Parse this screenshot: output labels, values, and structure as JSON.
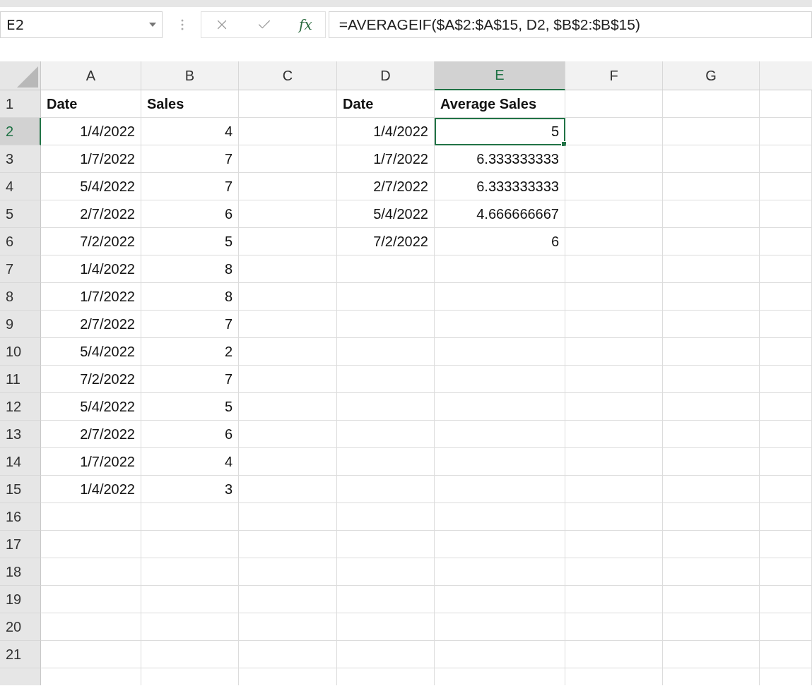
{
  "formula_bar": {
    "name_box": "E2",
    "function_label": "fx",
    "formula": "=AVERAGEIF($A$2:$A$15, D2, $B$2:$B$15)"
  },
  "columns": [
    {
      "label": "A",
      "selected": false
    },
    {
      "label": "B",
      "selected": false
    },
    {
      "label": "C",
      "selected": false
    },
    {
      "label": "D",
      "selected": false
    },
    {
      "label": "E",
      "selected": true
    },
    {
      "label": "F",
      "selected": false
    },
    {
      "label": "G",
      "selected": false
    }
  ],
  "rows": [
    {
      "number": "1",
      "selected": false,
      "cells": [
        {
          "kind": "header",
          "text": "Date"
        },
        {
          "kind": "header",
          "text": "Sales"
        },
        {
          "kind": "empty"
        },
        {
          "kind": "header",
          "text": "Date"
        },
        {
          "kind": "header",
          "text": "Average Sales"
        }
      ]
    },
    {
      "number": "2",
      "selected": true,
      "cells": [
        {
          "kind": "date",
          "text": "1/4/2022"
        },
        {
          "kind": "number",
          "text": "4"
        },
        {
          "kind": "empty"
        },
        {
          "kind": "date",
          "text": "1/4/2022"
        },
        {
          "kind": "number",
          "text": "5"
        }
      ]
    },
    {
      "number": "3",
      "selected": false,
      "cells": [
        {
          "kind": "date",
          "text": "1/7/2022"
        },
        {
          "kind": "number",
          "text": "7"
        },
        {
          "kind": "empty"
        },
        {
          "kind": "date",
          "text": "1/7/2022"
        },
        {
          "kind": "number",
          "text": "6.333333333"
        }
      ]
    },
    {
      "number": "4",
      "selected": false,
      "cells": [
        {
          "kind": "date",
          "text": "5/4/2022"
        },
        {
          "kind": "number",
          "text": "7"
        },
        {
          "kind": "empty"
        },
        {
          "kind": "date",
          "text": "2/7/2022"
        },
        {
          "kind": "number",
          "text": "6.333333333"
        }
      ]
    },
    {
      "number": "5",
      "selected": false,
      "cells": [
        {
          "kind": "date",
          "text": "2/7/2022"
        },
        {
          "kind": "number",
          "text": "6"
        },
        {
          "kind": "empty"
        },
        {
          "kind": "date",
          "text": "5/4/2022"
        },
        {
          "kind": "number",
          "text": "4.666666667"
        }
      ]
    },
    {
      "number": "6",
      "selected": false,
      "cells": [
        {
          "kind": "date",
          "text": "7/2/2022"
        },
        {
          "kind": "number",
          "text": "5"
        },
        {
          "kind": "empty"
        },
        {
          "kind": "date",
          "text": "7/2/2022"
        },
        {
          "kind": "number",
          "text": "6"
        }
      ]
    },
    {
      "number": "7",
      "selected": false,
      "cells": [
        {
          "kind": "date",
          "text": "1/4/2022"
        },
        {
          "kind": "number",
          "text": "8"
        }
      ]
    },
    {
      "number": "8",
      "selected": false,
      "cells": [
        {
          "kind": "date",
          "text": "1/7/2022"
        },
        {
          "kind": "number",
          "text": "8"
        }
      ]
    },
    {
      "number": "9",
      "selected": false,
      "cells": [
        {
          "kind": "date",
          "text": "2/7/2022"
        },
        {
          "kind": "number",
          "text": "7"
        }
      ]
    },
    {
      "number": "10",
      "selected": false,
      "cells": [
        {
          "kind": "date",
          "text": "5/4/2022"
        },
        {
          "kind": "number",
          "text": "2"
        }
      ]
    },
    {
      "number": "11",
      "selected": false,
      "cells": [
        {
          "kind": "date",
          "text": "7/2/2022"
        },
        {
          "kind": "number",
          "text": "7"
        }
      ]
    },
    {
      "number": "12",
      "selected": false,
      "cells": [
        {
          "kind": "date",
          "text": "5/4/2022"
        },
        {
          "kind": "number",
          "text": "5"
        }
      ]
    },
    {
      "number": "13",
      "selected": false,
      "cells": [
        {
          "kind": "date",
          "text": "2/7/2022"
        },
        {
          "kind": "number",
          "text": "6"
        }
      ]
    },
    {
      "number": "14",
      "selected": false,
      "cells": [
        {
          "kind": "date",
          "text": "1/7/2022"
        },
        {
          "kind": "number",
          "text": "4"
        }
      ]
    },
    {
      "number": "15",
      "selected": false,
      "cells": [
        {
          "kind": "date",
          "text": "1/4/2022"
        },
        {
          "kind": "number",
          "text": "3"
        }
      ]
    },
    {
      "number": "16",
      "selected": false
    },
    {
      "number": "17",
      "selected": false
    },
    {
      "number": "18",
      "selected": false
    },
    {
      "number": "19",
      "selected": false
    },
    {
      "number": "20",
      "selected": false
    },
    {
      "number": "21",
      "selected": false
    }
  ]
}
